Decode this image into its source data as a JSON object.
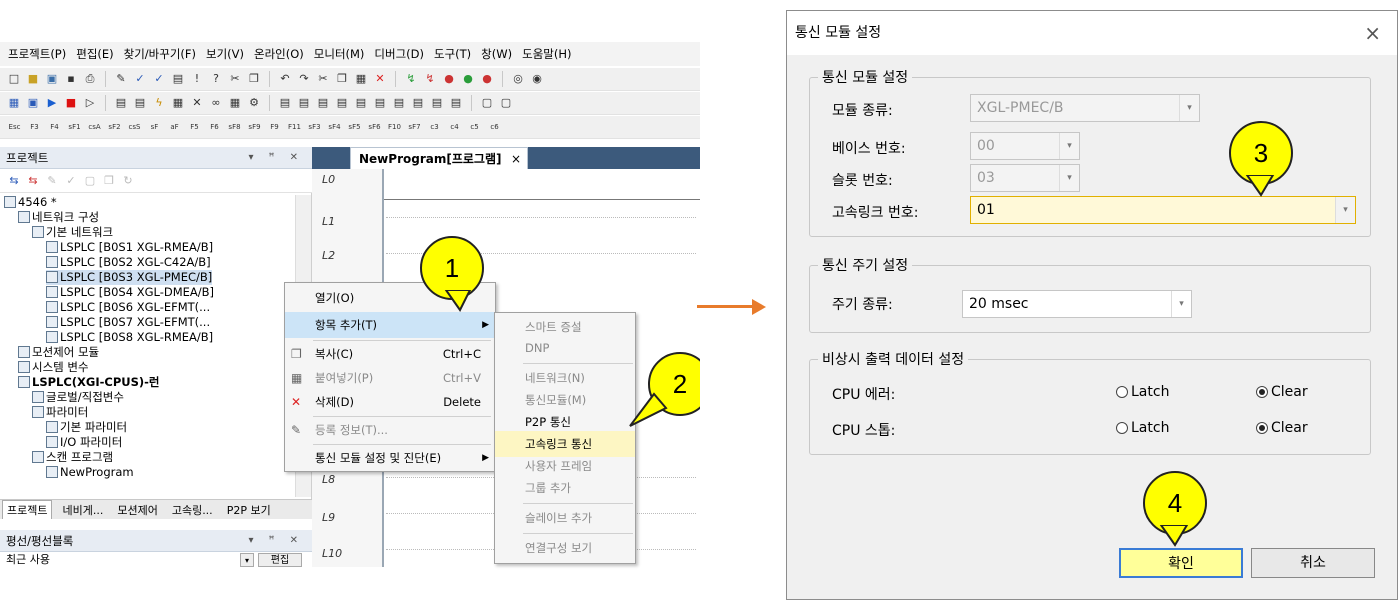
{
  "menubar": {
    "items": [
      "프로젝트(P)",
      "편집(E)",
      "찾기/바꾸기(F)",
      "보기(V)",
      "온라인(O)",
      "모니터(M)",
      "디버그(D)",
      "도구(T)",
      "창(W)",
      "도움말(H)"
    ]
  },
  "toolbar3_labels": [
    "Esc",
    "F3",
    "F4",
    "sF1",
    "csA",
    "sF2",
    "csS",
    "sF",
    "aF",
    "F5",
    "F6",
    "sF8",
    "sF9",
    "F9",
    "F11",
    "sF3",
    "sF4",
    "sF5",
    "sF6",
    "F10",
    "sF7",
    "c3",
    "c4",
    "c5",
    "c6"
  ],
  "project_pane": {
    "title": "프로젝트",
    "tree": [
      {
        "label": "4546 *",
        "indent": 0
      },
      {
        "label": "네트워크 구성",
        "indent": 1
      },
      {
        "label": "기본 네트워크",
        "indent": 2
      },
      {
        "label": "LSPLC [B0S1 XGL-RMEA/B]",
        "indent": 3
      },
      {
        "label": "LSPLC [B0S2 XGL-C42A/B]",
        "indent": 3
      },
      {
        "label": "LSPLC [B0S3 XGL-PMEC/B]",
        "indent": 3,
        "selected": true
      },
      {
        "label": "LSPLC [B0S4 XGL-DMEA/B]",
        "indent": 3
      },
      {
        "label": "LSPLC [B0S6 XGL-EFMT(...",
        "indent": 3
      },
      {
        "label": "LSPLC [B0S7 XGL-EFMT(...",
        "indent": 3
      },
      {
        "label": "LSPLC [B0S8 XGL-RMEA/B]",
        "indent": 3
      },
      {
        "label": "모션제어 모듈",
        "indent": 1
      },
      {
        "label": "시스템 변수",
        "indent": 1
      },
      {
        "label": "LSPLC(XGI-CPUS)-런",
        "indent": 1,
        "bold": true
      },
      {
        "label": "글로벌/직접변수",
        "indent": 2
      },
      {
        "label": "파라미터",
        "indent": 2
      },
      {
        "label": "기본 파라미터",
        "indent": 3
      },
      {
        "label": "I/O 파라미터",
        "indent": 3
      },
      {
        "label": "스캔 프로그램",
        "indent": 2
      },
      {
        "label": "NewProgram",
        "indent": 3
      }
    ],
    "bottom_tabs": [
      "프로젝트",
      "네비게...",
      "모션제어",
      "고속링...",
      "P2P 보기"
    ]
  },
  "pane2": {
    "title": "평선/평선블록",
    "row_text": "최근 사용",
    "edit_label": "편집"
  },
  "ladder": {
    "tab_title": "NewProgram[프로그램]",
    "tab_close": "×",
    "rungs": [
      "L0",
      "L1",
      "L2",
      "L8",
      "L9",
      "L10"
    ]
  },
  "context_menu": {
    "items": [
      {
        "label": "열기(O)",
        "key": "",
        "state": "normal"
      },
      {
        "label": "항목 추가(T)",
        "key": "",
        "state": "highlight",
        "submenu": true
      },
      {
        "label": "복사(C)",
        "key": "Ctrl+C",
        "state": "normal"
      },
      {
        "label": "붙여넣기(P)",
        "key": "Ctrl+V",
        "state": "disabled"
      },
      {
        "label": "삭제(D)",
        "key": "Delete",
        "state": "normal"
      },
      {
        "label": "등록 정보(T)...",
        "key": "",
        "state": "disabled"
      },
      {
        "label": "통신 모듈 설정 및 진단(E)",
        "key": "",
        "state": "normal",
        "submenu": true
      }
    ]
  },
  "submenu": {
    "items": [
      {
        "label": "스마트 증설",
        "state": "disabled"
      },
      {
        "label": "DNP",
        "state": "disabled"
      },
      {
        "label": "네트워크(N)",
        "state": "disabled"
      },
      {
        "label": "통신모듈(M)",
        "state": "disabled"
      },
      {
        "label": "P2P 통신",
        "state": "normal"
      },
      {
        "label": "고속링크 통신",
        "state": "highlight"
      },
      {
        "label": "사용자 프레임",
        "state": "disabled"
      },
      {
        "label": "그룹 추가",
        "state": "disabled"
      },
      {
        "label": "슬레이브 추가",
        "state": "disabled"
      },
      {
        "label": "연결구성 보기",
        "state": "disabled"
      }
    ]
  },
  "callouts": [
    "1",
    "2",
    "3",
    "4"
  ],
  "dialog": {
    "title": "통신 모듈 설정",
    "close": "×",
    "group1": {
      "label": "통신 모듈 설정",
      "module_type_label": "모듈 종류:",
      "module_type_value": "XGL-PMEC/B",
      "base_label": "베이스 번호:",
      "base_value": "00",
      "slot_label": "슬롯 번호:",
      "slot_value": "03",
      "hslink_label": "고속링크 번호:",
      "hslink_value": "01"
    },
    "group2": {
      "label": "통신 주기 설정",
      "period_label": "주기 종류:",
      "period_value": "20 msec"
    },
    "group3": {
      "label": "비상시 출력 데이터 설정",
      "cpu_error_label": "CPU 에러:",
      "cpu_stop_label": "CPU 스톱:",
      "latch_label": "Latch",
      "clear_label": "Clear",
      "cpu_error_selected": "Clear",
      "cpu_stop_selected": "Clear"
    },
    "ok_label": "확인",
    "cancel_label": "취소"
  },
  "colors": {
    "callout": "#ffff00",
    "arrow": "#e87b2b",
    "highlight": "#cce4f7",
    "field_highlight": "#fff9d8"
  }
}
